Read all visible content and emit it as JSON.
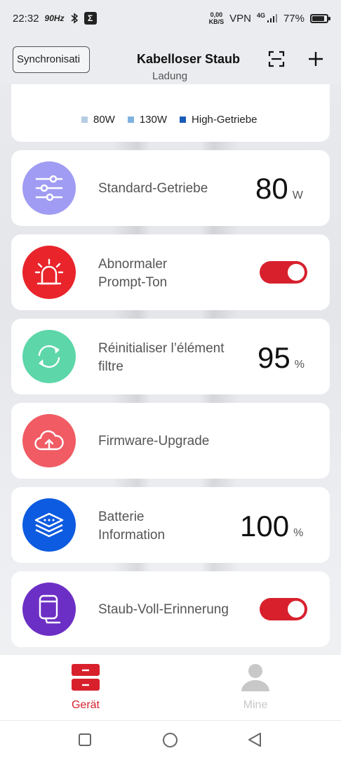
{
  "status_bar": {
    "time": "22:32",
    "refresh_rate": "90Hz",
    "net_speed_value": "0,00",
    "net_speed_unit": "KB/S",
    "vpn": "VPN",
    "network": "4G",
    "battery_pct": "77%"
  },
  "header": {
    "sync_button": "Synchronisati",
    "title": "Kabelloser Staub",
    "subtitle": "Ladung"
  },
  "legend": {
    "cut_text": "",
    "items": [
      {
        "label": "80W",
        "color": "#b5cde3"
      },
      {
        "label": "130W",
        "color": "#7fb3e0"
      },
      {
        "label": "High-Getriebe",
        "color": "#1a5bb8"
      }
    ]
  },
  "cards": {
    "standard": {
      "label": "Standard-Getriebe",
      "value": "80",
      "unit": "W",
      "icon": "sliders-icon",
      "color": "#a09cf3"
    },
    "prompt": {
      "label_line1": "Abnormaler",
      "label_line2": "Prompt-Ton",
      "toggle_on": true,
      "icon": "alarm-icon",
      "color": "#e9242b"
    },
    "filter": {
      "label_line1": "Réinitialiser l’élément",
      "label_line2": "filtre",
      "value": "95",
      "unit": "%",
      "icon": "refresh-icon",
      "color": "#5dd6aa"
    },
    "firmware": {
      "label": "Firmware-Upgrade",
      "icon": "cloud-upload-icon",
      "color": "#f05b64"
    },
    "battery": {
      "label_line1": "Batterie",
      "label_line2": "Information",
      "value": "100",
      "unit": "%",
      "icon": "layers-icon",
      "color": "#0d5be0"
    },
    "dust": {
      "label": "Staub-Voll-Erinnerung",
      "toggle_on": true,
      "icon": "dustbin-icon",
      "color": "#6c2fc5"
    }
  },
  "tabs": [
    {
      "label": "Gerät",
      "active": true,
      "color": "#d8202d"
    },
    {
      "label": "Mine",
      "active": false,
      "color": "#c8c8c8"
    }
  ]
}
